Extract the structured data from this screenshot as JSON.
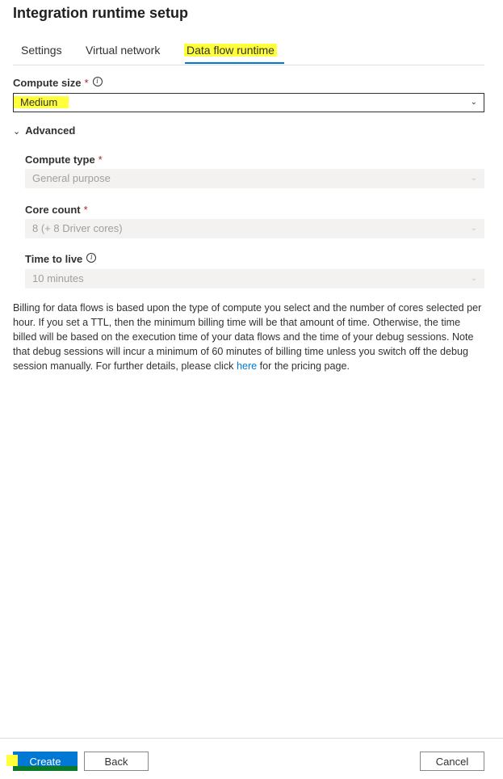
{
  "panel": {
    "title": "Integration runtime setup"
  },
  "tabs": [
    {
      "label": "Settings",
      "active": false
    },
    {
      "label": "Virtual network",
      "active": false
    },
    {
      "label": "Data flow runtime",
      "active": true
    }
  ],
  "compute_size": {
    "label": "Compute size",
    "required_mark": "*",
    "value": "Medium",
    "info_icon": "info-icon"
  },
  "advanced": {
    "label": "Advanced",
    "expanded": true,
    "compute_type": {
      "label": "Compute type",
      "required_mark": "*",
      "value": "General purpose"
    },
    "core_count": {
      "label": "Core count",
      "required_mark": "*",
      "value": "8 (+ 8 Driver cores)"
    },
    "time_to_live": {
      "label": "Time to live",
      "value": "10 minutes",
      "info_icon": "info-icon"
    }
  },
  "billing": {
    "text_before_link": "Billing for data flows is based upon the type of compute you select and the number of cores selected per hour. If you set a TTL, then the minimum billing time will be that amount of time. Otherwise, the time billed will be based on the execution time of your data flows and the time of your debug sessions. Note that debug sessions will incur a minimum of 60 minutes of billing time unless you switch off the debug session manually. For further details, please click ",
    "link_text": "here",
    "text_after_link": " for the pricing page."
  },
  "footer": {
    "create_label": "Create",
    "back_label": "Back",
    "cancel_label": "Cancel"
  },
  "colors": {
    "accent": "#0078d4",
    "highlight": "#ffff3c",
    "required": "#a4262c"
  }
}
